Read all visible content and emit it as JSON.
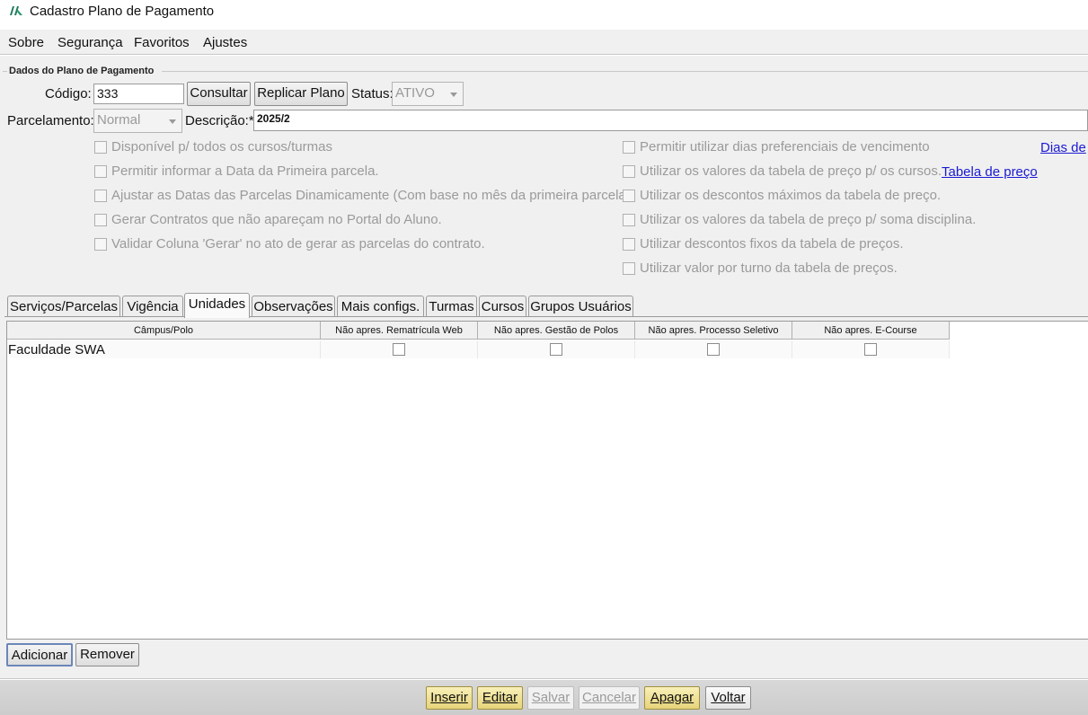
{
  "window": {
    "title": "Cadastro Plano de Pagamento",
    "logo_icon": "app-logo-icon"
  },
  "menu": [
    {
      "label": "Sobre"
    },
    {
      "label": "Segurança"
    },
    {
      "label": "Favoritos"
    },
    {
      "label": "Ajustes"
    }
  ],
  "group": {
    "title": "Dados do Plano de Pagamento"
  },
  "form": {
    "codigo_label": "Código:",
    "codigo_value": "333",
    "consultar_label": "Consultar",
    "replicar_label": "Replicar Plano",
    "status_label": "Status:",
    "status_value": "ATIVO",
    "parcelamento_label": "Parcelamento:",
    "parcelamento_value": "Normal",
    "descricao_label": "Descrição:*",
    "descricao_value": "2025/2"
  },
  "options_left": [
    "Disponível p/ todos os cursos/turmas",
    "Permitir informar a Data da Primeira parcela.",
    "Ajustar as Datas das Parcelas Dinamicamente (Com base no mês da primeira parcela)",
    "Gerar Contratos que não apareçam no Portal do Aluno.",
    "Validar Coluna 'Gerar' no ato de gerar as parcelas do contrato."
  ],
  "options_right": [
    "Permitir utilizar dias preferenciais de vencimento",
    "Utilizar os valores da tabela de preço p/ os cursos.",
    "Utilizar os descontos máximos da tabela de preço.",
    "Utilizar os valores da tabela de preço p/ soma disciplina.",
    "Utilizar descontos fixos da tabela de preços.",
    "Utilizar valor por turno da tabela de preços."
  ],
  "links": {
    "dias": "Dias de",
    "tabela": "Tabela de preço"
  },
  "tabs": [
    {
      "label": "Serviços/Parcelas"
    },
    {
      "label": "Vigência"
    },
    {
      "label": "Unidades"
    },
    {
      "label": "Observações"
    },
    {
      "label": "Mais configs."
    },
    {
      "label": "Turmas"
    },
    {
      "label": "Cursos"
    },
    {
      "label": "Grupos Usuários"
    }
  ],
  "table": {
    "columns": [
      "Câmpus/Polo",
      "Não apres. Rematrícula Web",
      "Não apres. Gestão de Polos",
      "Não apres. Processo Seletivo",
      "Não apres. E-Course"
    ],
    "rows": [
      {
        "campus": "Faculdade SWA",
        "checks": [
          false,
          false,
          false,
          false
        ]
      }
    ]
  },
  "tab_buttons": {
    "adicionar": "Adicionar",
    "remover": "Remover"
  },
  "footer": {
    "inserir": "Inserir",
    "editar": "Editar",
    "salvar": "Salvar",
    "cancelar": "Cancelar",
    "apagar": "Apagar",
    "voltar": "Voltar"
  }
}
